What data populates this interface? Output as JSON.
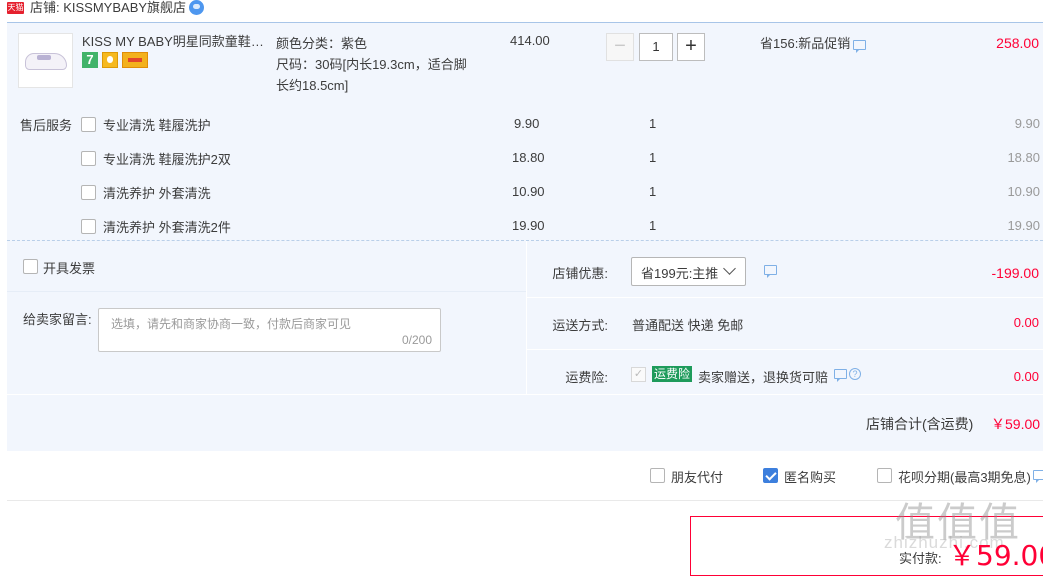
{
  "shop": {
    "badge": "天猫",
    "name": "店铺: KISSMYBABY旗舰店"
  },
  "product": {
    "title": "KISS MY BABY明星同款童鞋儿童小白鞋",
    "badge_7": "7",
    "sku_color": "颜色分类：紫色",
    "sku_size_1": "尺码：30码[内长19.3cm，适合脚",
    "sku_size_2": "长约18.5cm]",
    "price": "414.00",
    "qty_minus": "−",
    "qty": "1",
    "qty_plus": "+",
    "promo": "省156:新品促销",
    "subtotal": "258.00"
  },
  "services": {
    "label": "售后服务",
    "items": [
      {
        "name": "专业清洗 鞋履洗护",
        "price": "9.90",
        "qty": "1",
        "subtotal": "9.90"
      },
      {
        "name": "专业清洗 鞋履洗护2双",
        "price": "18.80",
        "qty": "1",
        "subtotal": "18.80"
      },
      {
        "name": "清洗养护 外套清洗",
        "price": "10.90",
        "qty": "1",
        "subtotal": "10.90"
      },
      {
        "name": "清洗养护 外套清洗2件",
        "price": "19.90",
        "qty": "1",
        "subtotal": "19.90"
      }
    ]
  },
  "invoice": {
    "label": "开具发票"
  },
  "message": {
    "label": "给卖家留言:",
    "placeholder": "选填，请先和商家协商一致，付款后商家可见",
    "count": "0/200"
  },
  "discount": {
    "label": "店铺优惠:",
    "selected": "省199元:主推",
    "value": "-199.00"
  },
  "shipping": {
    "label": "运送方式:",
    "method": "普通配送 快递 免邮",
    "value": "0.00"
  },
  "insurance": {
    "label": "运费险:",
    "tag": "运费险",
    "text": "卖家赠送，退换货可赔",
    "help": "?",
    "value": "0.00"
  },
  "shop_total": {
    "label": "店铺合计(含运费)",
    "value": "￥59.00"
  },
  "options": {
    "friend_pay": "朋友代付",
    "anonymous": "匿名购买",
    "huabei": "花呗分期(最高3期免息)"
  },
  "payment": {
    "label": "实付款:",
    "value": "￥59.00"
  },
  "watermark": {
    "logo": "值值值",
    "url": "zhizhuzhi.com"
  },
  "colors": {
    "price_red": "#ff0036",
    "panel_bg": "#f2f6fd",
    "check_blue": "#3d7fdd",
    "ins_green": "#1e9b5b"
  }
}
